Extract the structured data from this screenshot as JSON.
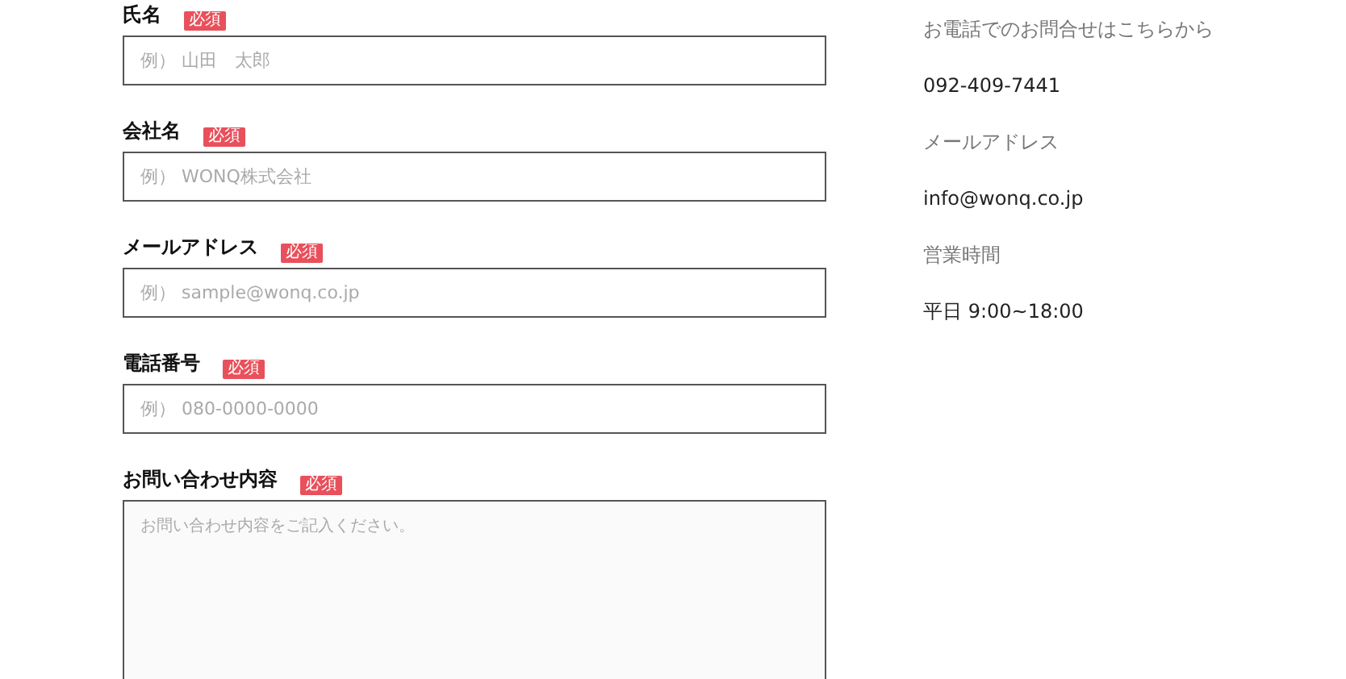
{
  "form": {
    "fields": [
      {
        "kind": "input",
        "label": "氏名",
        "badge": "必須",
        "placeholder": "例） 山田　太郎"
      },
      {
        "kind": "input",
        "label": "会社名",
        "badge": "必須",
        "placeholder": "例） WONQ株式会社"
      },
      {
        "kind": "input",
        "label": "メールアドレス",
        "badge": "必須",
        "placeholder": "例） sample@wonq.co.jp"
      },
      {
        "kind": "input",
        "label": "電話番号",
        "badge": "必須",
        "placeholder": "例） 080-0000-0000"
      },
      {
        "kind": "textarea",
        "label": "お問い合わせ内容",
        "badge": "必須",
        "placeholder": "お問い合わせ内容をご記入ください。"
      }
    ]
  },
  "contact_info": [
    {
      "kind": "heading",
      "text": "お電話でのお問合せはこちらから"
    },
    {
      "kind": "value",
      "text": "092-409-7441"
    },
    {
      "kind": "heading",
      "text": "メールアドレス"
    },
    {
      "kind": "value",
      "text": "info@wonq.co.jp"
    },
    {
      "kind": "heading",
      "text": "営業時間"
    },
    {
      "kind": "value",
      "text": "平日 9:00~18:00"
    }
  ]
}
